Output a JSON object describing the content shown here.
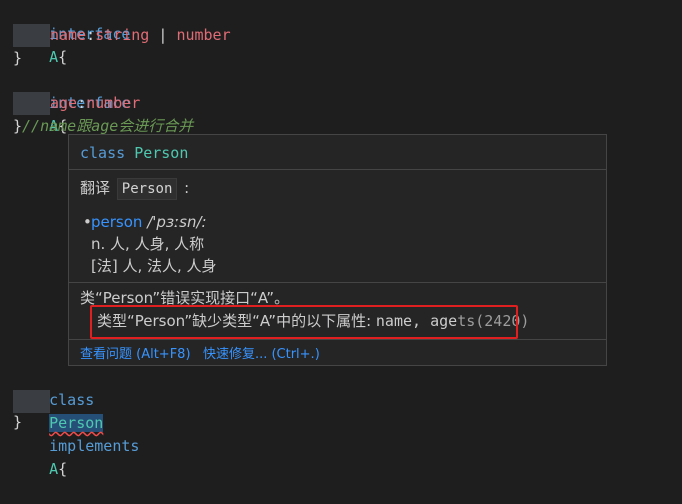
{
  "code": {
    "line1": {
      "kw": "interface",
      "name": "A",
      "brace": "{"
    },
    "line2": {
      "prop": "name",
      "colon": ":",
      "type1": "string",
      "pipe": " | ",
      "type2": "number"
    },
    "line3": "}",
    "line4": {
      "kw": "interface",
      "name": "A",
      "brace": "{"
    },
    "line5": {
      "prop": "age",
      "colon": ":",
      "type1": "number"
    },
    "line6": {
      "brace": "}",
      "comment": "//name跟age会进行合并"
    },
    "line7": {
      "kw": "class",
      "name": "Person",
      "kw2": "implements",
      "iface": "A",
      "brace": "{"
    },
    "line9": "}"
  },
  "hover": {
    "signature_kw": "class",
    "signature_name": "Person",
    "translate_label": "翻译",
    "translate_word": "Person",
    "translate_colon": ":",
    "dict_word": "person",
    "dict_phonetic": "/'pɜːsn/:",
    "dict_def1": "n. 人, 人身, 人称",
    "dict_def2": "[法] 人, 法人, 人身",
    "diag_line1": "类“Person”错误实现接口“A”。",
    "diag_line2_prefix": "类型“Person”缺少类型“A”中的以下属性: ",
    "diag_line2_mono": "name, age",
    "diag_code": "ts(2420)",
    "action_view": "查看问题 (Alt+F8)",
    "action_fix": "快速修复... (Ctrl+.)"
  },
  "colors": {
    "keyword": "#569cd6",
    "type": "#4ec9b0",
    "property": "#e06c75",
    "comment": "#6a9955",
    "link": "#3794ff",
    "highlight_box": "#e02020"
  }
}
